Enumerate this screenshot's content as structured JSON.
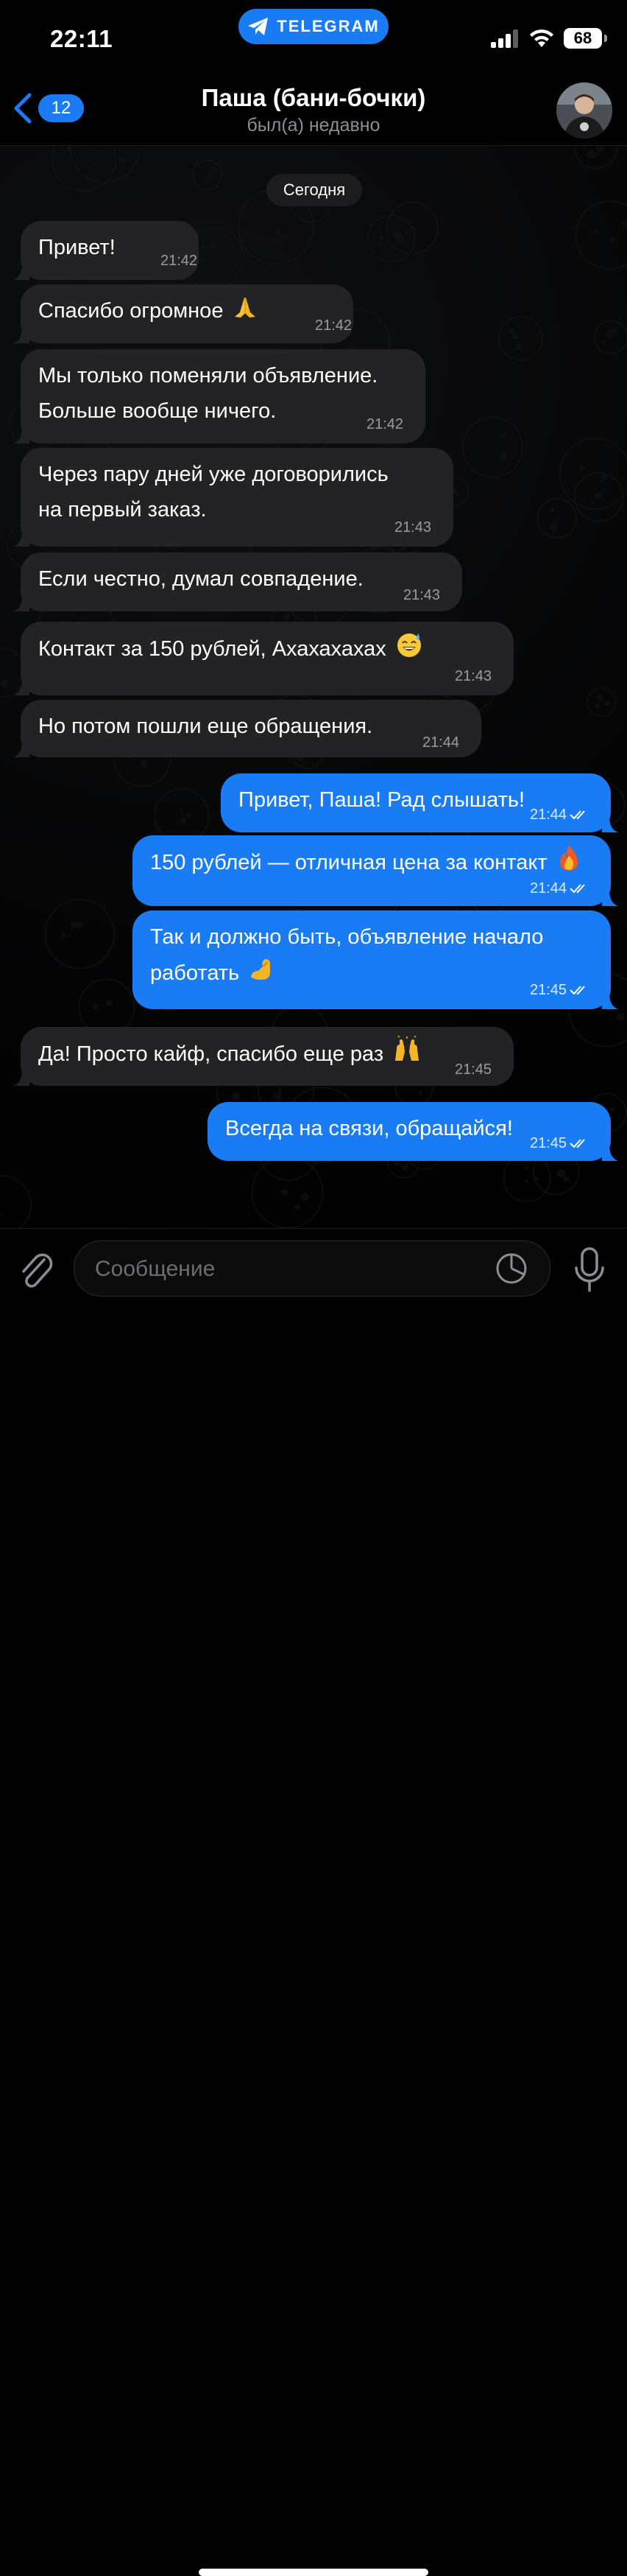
{
  "status_bar": {
    "time": "22:11",
    "app_pill": "TELEGRAM",
    "battery": "68"
  },
  "header": {
    "back_count": "12",
    "title": "Паша (бани-бочки)",
    "subtitle": "был(а) недавно"
  },
  "date_label": "Сегодня",
  "messages": [
    {
      "dir": "in",
      "lines": [
        "Привет!"
      ],
      "time": "21:42"
    },
    {
      "dir": "in",
      "lines": [
        "Спасибо огромное"
      ],
      "emoji": "pray",
      "time": "21:42"
    },
    {
      "dir": "in",
      "lines": [
        "Мы только поменяли объявление.",
        "Больше вообще ничего."
      ],
      "time": "21:42"
    },
    {
      "dir": "in",
      "lines": [
        "Через пару дней уже договорились",
        "на первый заказ."
      ],
      "time": "21:43"
    },
    {
      "dir": "in",
      "lines": [
        "Если честно, думал совпадение."
      ],
      "time": "21:43"
    },
    {
      "dir": "in",
      "lines": [
        "Контакт за 150 рублей, Ахахахахах"
      ],
      "emoji": "sweat-smile",
      "time": "21:43"
    },
    {
      "dir": "in",
      "lines": [
        "Но потом пошли еще обращения."
      ],
      "time": "21:44"
    },
    {
      "dir": "out",
      "lines": [
        "Привет, Паша! Рад слышать!"
      ],
      "time": "21:44",
      "read": true
    },
    {
      "dir": "out",
      "lines": [
        "150 рублей — отличная цена за контакт"
      ],
      "emoji": "fire",
      "time": "21:44",
      "read": true
    },
    {
      "dir": "out",
      "lines": [
        "Так и должно быть, объявление начало",
        "работать"
      ],
      "emoji": "muscle",
      "time": "21:45",
      "read": true
    },
    {
      "dir": "in",
      "lines": [
        "Да! Просто кайф, спасибо еще раз"
      ],
      "emoji": "raised-hands",
      "time": "21:45"
    },
    {
      "dir": "out",
      "lines": [
        "Всегда на связи, обращайся!"
      ],
      "time": "21:45",
      "read": true
    }
  ],
  "input": {
    "placeholder": "Сообщение"
  },
  "colors": {
    "accent": "#1a7cf5",
    "incoming_bubble": "#232325",
    "background": "#000000"
  },
  "icons": [
    "telegram-plane-icon",
    "signal-icon",
    "wifi-icon",
    "battery-icon",
    "back-chevron-icon",
    "paperclip-icon",
    "sticker-icon",
    "microphone-icon",
    "double-check-icon"
  ]
}
